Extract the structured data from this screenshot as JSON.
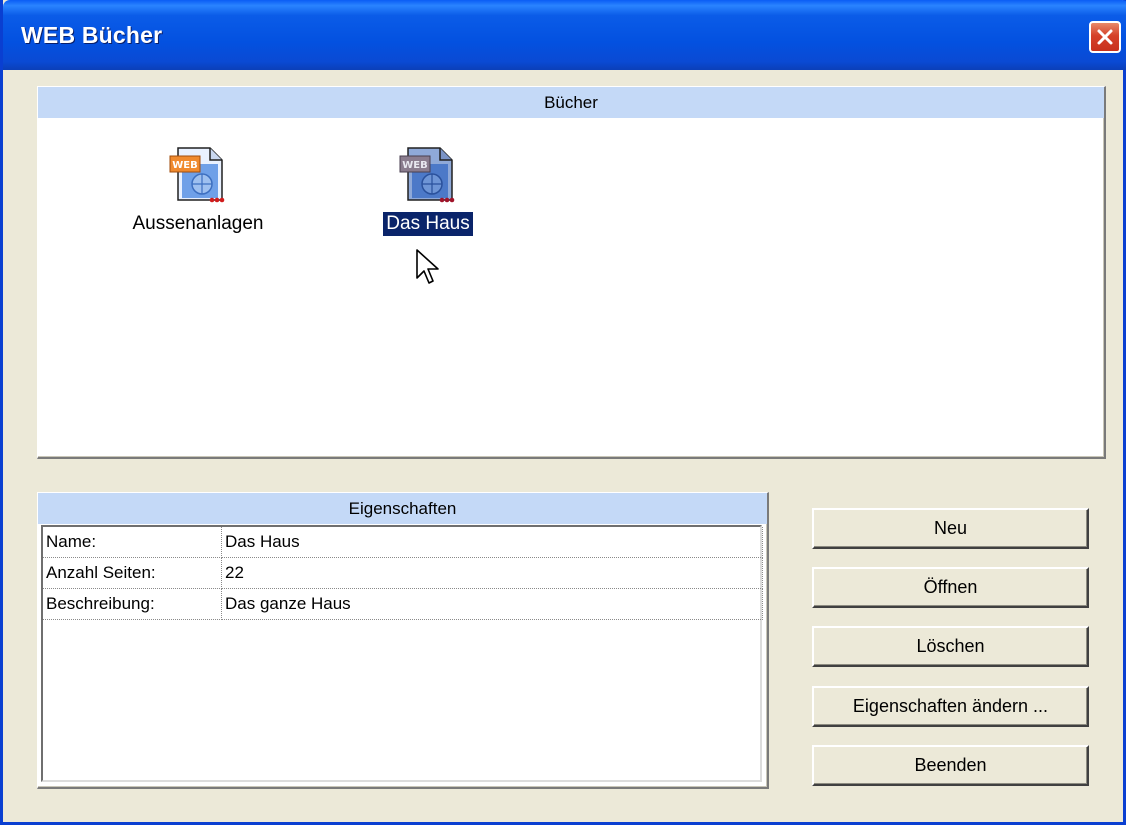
{
  "window": {
    "title": "WEB Bücher"
  },
  "books_panel": {
    "header": "Bücher",
    "items": [
      {
        "label": "Aussenanlagen",
        "icon": "web-book-icon",
        "selected": false
      },
      {
        "label": "Das Haus",
        "icon": "web-book-icon",
        "selected": true
      }
    ]
  },
  "properties_panel": {
    "header": "Eigenschaften",
    "rows": [
      {
        "key": "Name:",
        "value": "Das Haus"
      },
      {
        "key": "Anzahl Seiten:",
        "value": "22"
      },
      {
        "key": "Beschreibung:",
        "value": "Das ganze Haus"
      }
    ]
  },
  "buttons": {
    "new": "Neu",
    "open": "Öffnen",
    "delete": "Löschen",
    "edit_properties": "Eigenschaften ändern ...",
    "quit": "Beenden"
  },
  "colors": {
    "titlebar": "#0351e0",
    "panel_header": "#c4d9f7",
    "selection": "#0a246a",
    "window_bg": "#ece9d8"
  }
}
